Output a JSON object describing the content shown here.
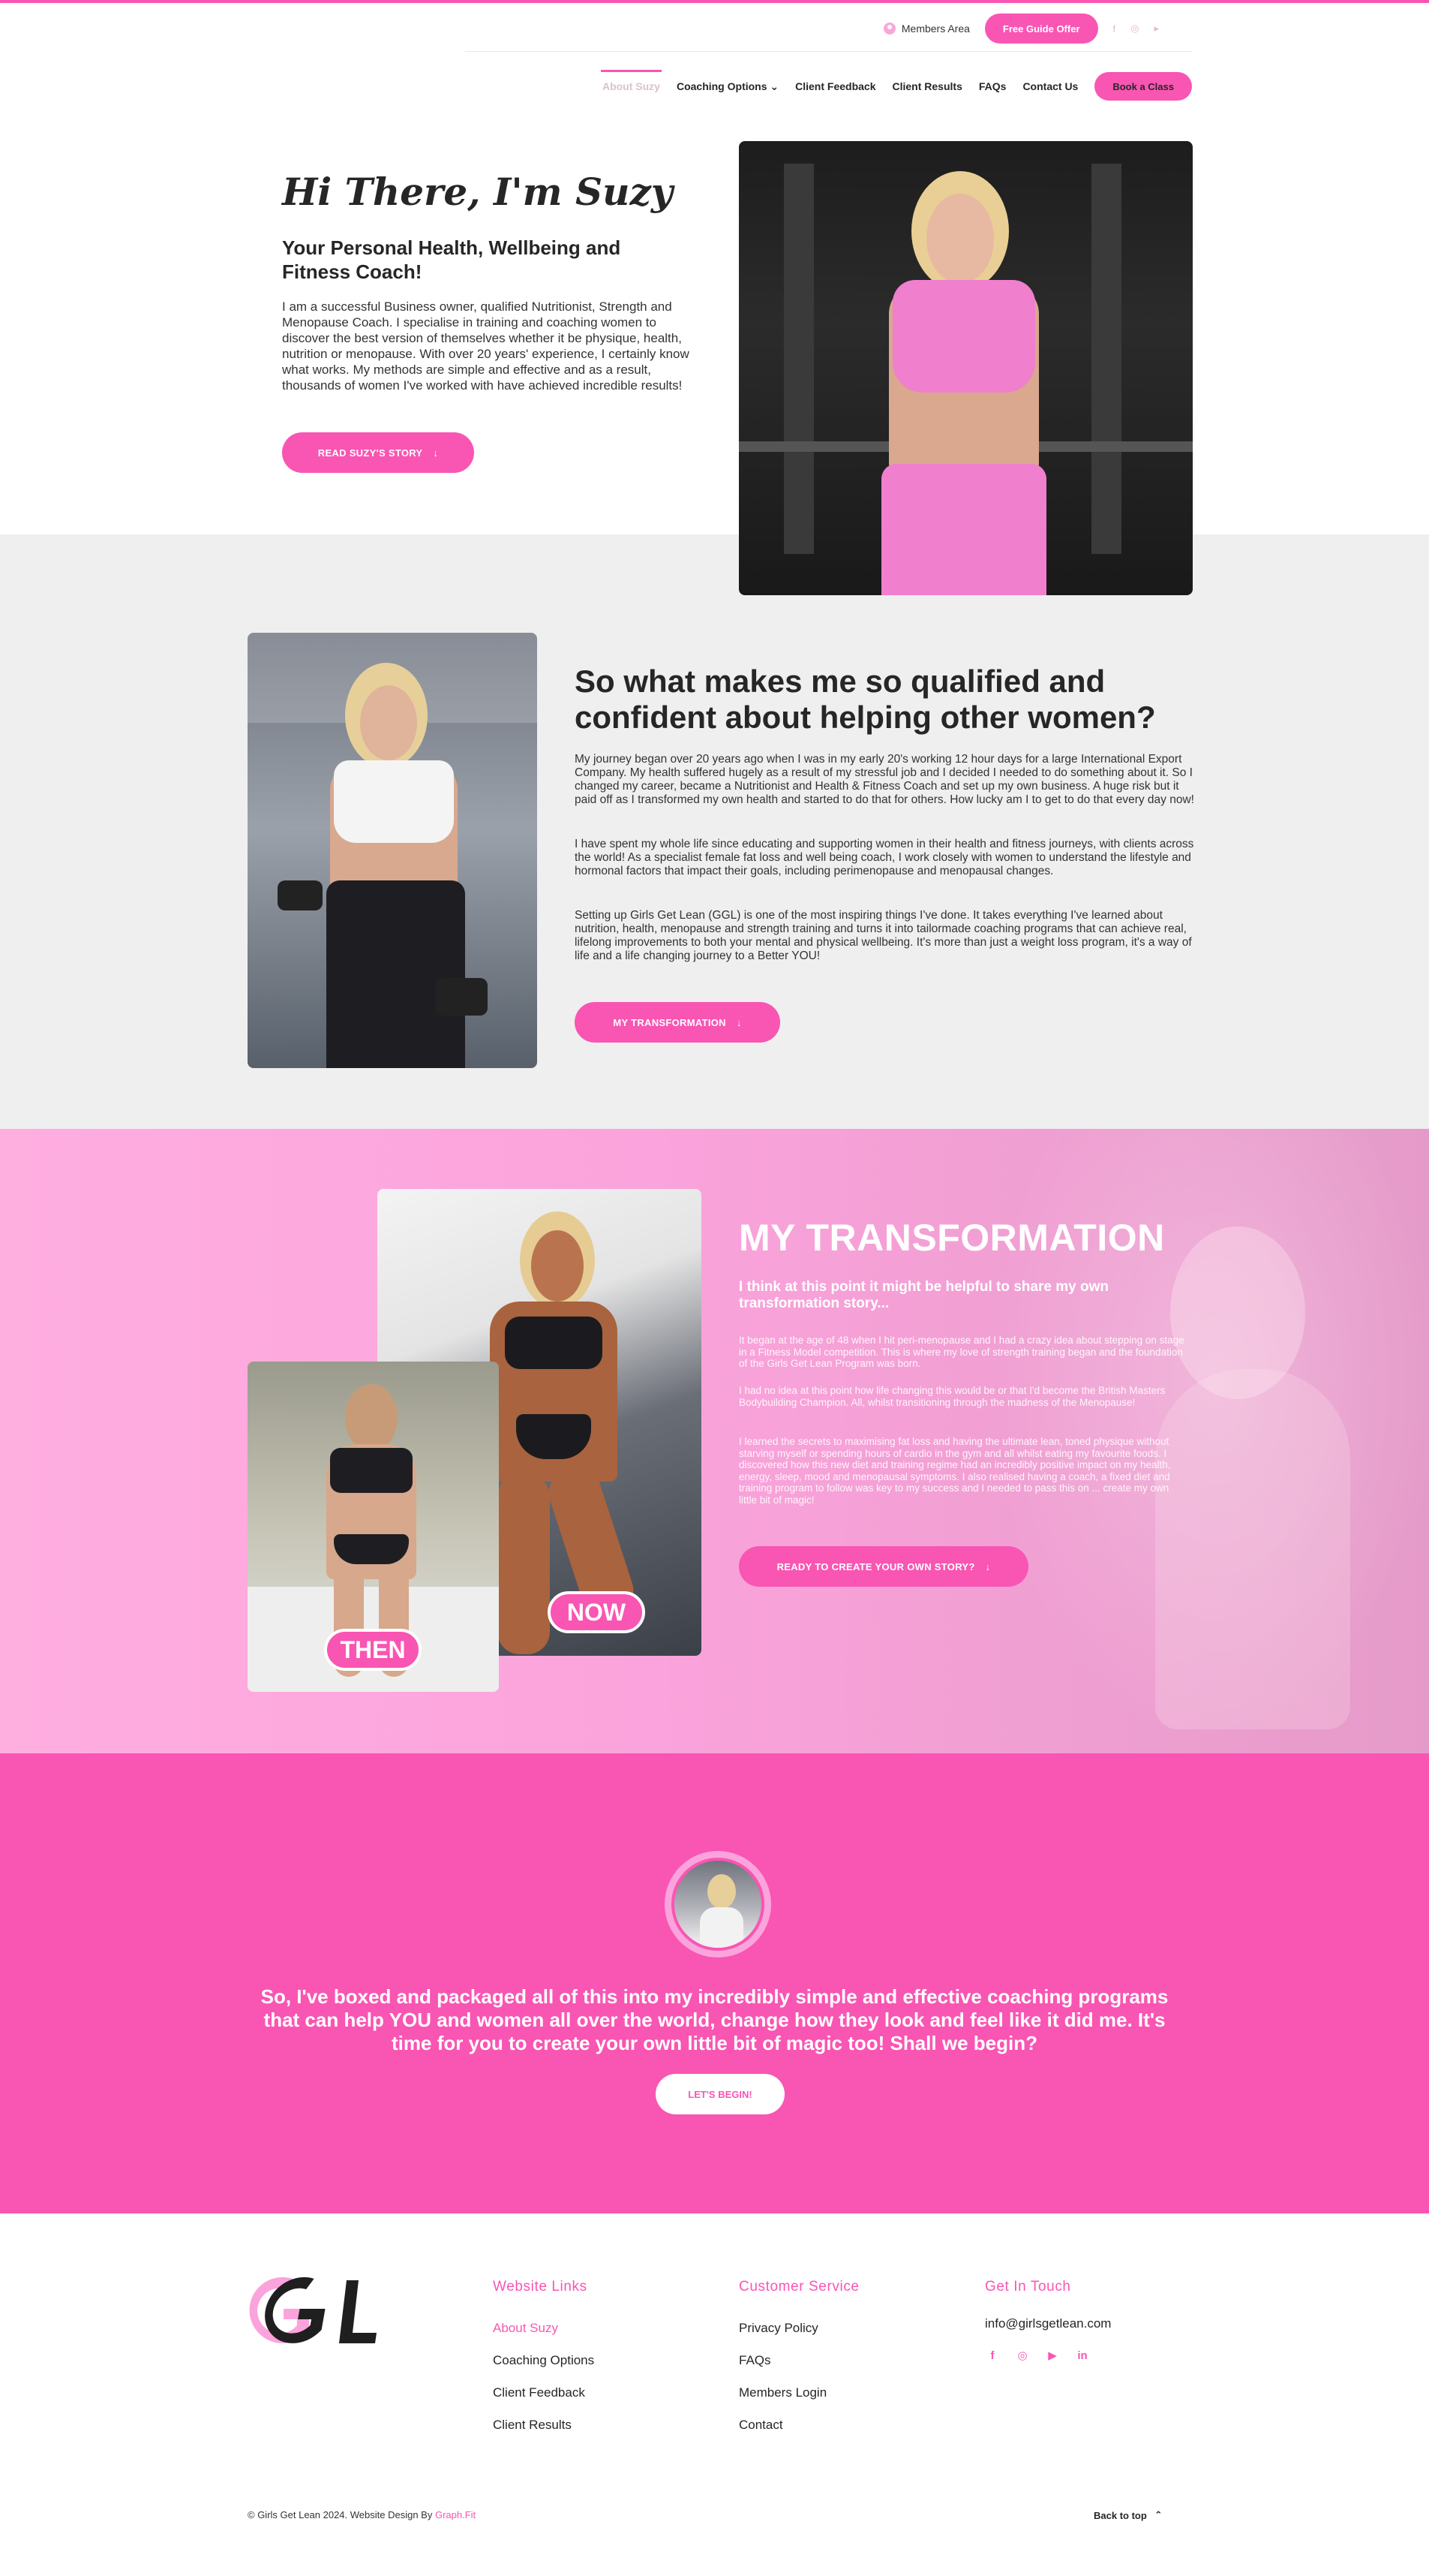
{
  "header": {
    "members_label": "Members Area",
    "free_guide_label": "Free Guide Offer",
    "social_icons": [
      "facebook-icon",
      "instagram-icon",
      "youtube-icon"
    ],
    "nav": [
      {
        "label": "About Suzy",
        "active": true
      },
      {
        "label": "Coaching Options ⌄"
      },
      {
        "label": "Client Feedback"
      },
      {
        "label": "Client Results"
      },
      {
        "label": "FAQs"
      },
      {
        "label": "Contact Us"
      }
    ],
    "book_label": "Book a Class"
  },
  "hero": {
    "title": "Hi There, I'm Suzy",
    "subtitle": "Your Personal Health, Wellbeing and Fitness Coach!",
    "body": "I am a successful Business owner, qualified Nutritionist, Strength and Menopause Coach. I specialise in training and coaching women to discover the best version of themselves whether it be physique, health, nutrition or menopause. With over 20 years' experience, I certainly know what works. My methods are simple and effective and as a result, thousands of women I've worked with have achieved incredible results!",
    "button": "READ SUZY'S STORY"
  },
  "qualified": {
    "title": "So what makes me so qualified and confident about helping other women?",
    "p1": "My journey began over 20 years ago when I was in my early 20's working 12 hour days for a large International Export Company. My health suffered hugely as a result of my stressful job and I decided I needed to do something about it. So I changed my career, became a Nutritionist and Health & Fitness Coach and set up my own business. A huge risk but it paid off as I transformed my own health and started to do that for others. How lucky am I to get to do that every day now!",
    "p2": "I have spent my whole life since educating and supporting women in their health and fitness journeys, with clients across the world! As a specialist female fat loss and well being coach, I work closely with women to understand the lifestyle and hormonal factors that impact their goals, including perimenopause and menopausal changes.",
    "p3": "Setting up Girls Get Lean (GGL) is one of the most inspiring things I've done. It takes everything I've learned about nutrition, health, menopause and strength training and turns it into tailormade coaching programs that can achieve real, lifelong improvements to both your mental and physical wellbeing. It's more than just a weight loss program, it's a way of life and a life changing journey to a Better YOU!",
    "button": "MY TRANSFORMATION"
  },
  "transformation": {
    "now_label": "NOW",
    "then_label": "THEN",
    "title": "MY TRANSFORMATION",
    "lead": "I think at this point it might be helpful to share my own transformation story...",
    "p1": "It began at the age of 48 when I hit peri-menopause and I had a crazy idea about stepping on stage in a Fitness Model competition. This is where my love of strength training began and the foundation of the Girls Get Lean Program was born.",
    "p2": "I had no idea at this point how life changing this would be or that I'd become the British Masters Bodybuilding Champion. All, whilst transitioning through the madness of the Menopause!",
    "p3": "I learned the secrets to maximising fat loss and having the ultimate lean, toned physique without starving myself or spending hours of cardio in the gym and all whilst eating my favourite foods. I discovered how this new diet and training regime had an incredibly positive impact on my health, energy, sleep, mood and menopausal symptoms. I also realised having a coach, a fixed diet and training program to follow was key to my success and I needed to pass this on ... create my own little bit of magic!",
    "button": "READY TO CREATE YOUR OWN STORY?"
  },
  "cta": {
    "text": "So, I've boxed and packaged all of this into my incredibly simple and effective coaching programs that can help YOU and women all over the world, change how they look and feel like it did me. It's time for you to create your own little bit of magic too! Shall we begin?",
    "button": "LET'S BEGIN!"
  },
  "footer": {
    "logo_text": "GGL",
    "col1": {
      "title": "Website Links",
      "links": [
        "About Suzy",
        "Coaching Options",
        "Client Feedback",
        "Client Results"
      ]
    },
    "col2": {
      "title": "Customer Service",
      "links": [
        "Privacy Policy",
        "FAQs",
        "Members Login",
        "Contact"
      ]
    },
    "col3": {
      "title": "Get In Touch",
      "email": "info@girlsgetlean.com",
      "social_icons": [
        "facebook-icon",
        "instagram-icon",
        "youtube-icon",
        "linkedin-icon"
      ]
    },
    "copyright": "© Girls Get Lean 2024. Website Design By ",
    "designer": "Graph.Fit",
    "back_to_top": "Back to top"
  },
  "colors": {
    "accent": "#f955b3",
    "light_pink": "#fba3dc",
    "grey_band": "#efefef"
  }
}
